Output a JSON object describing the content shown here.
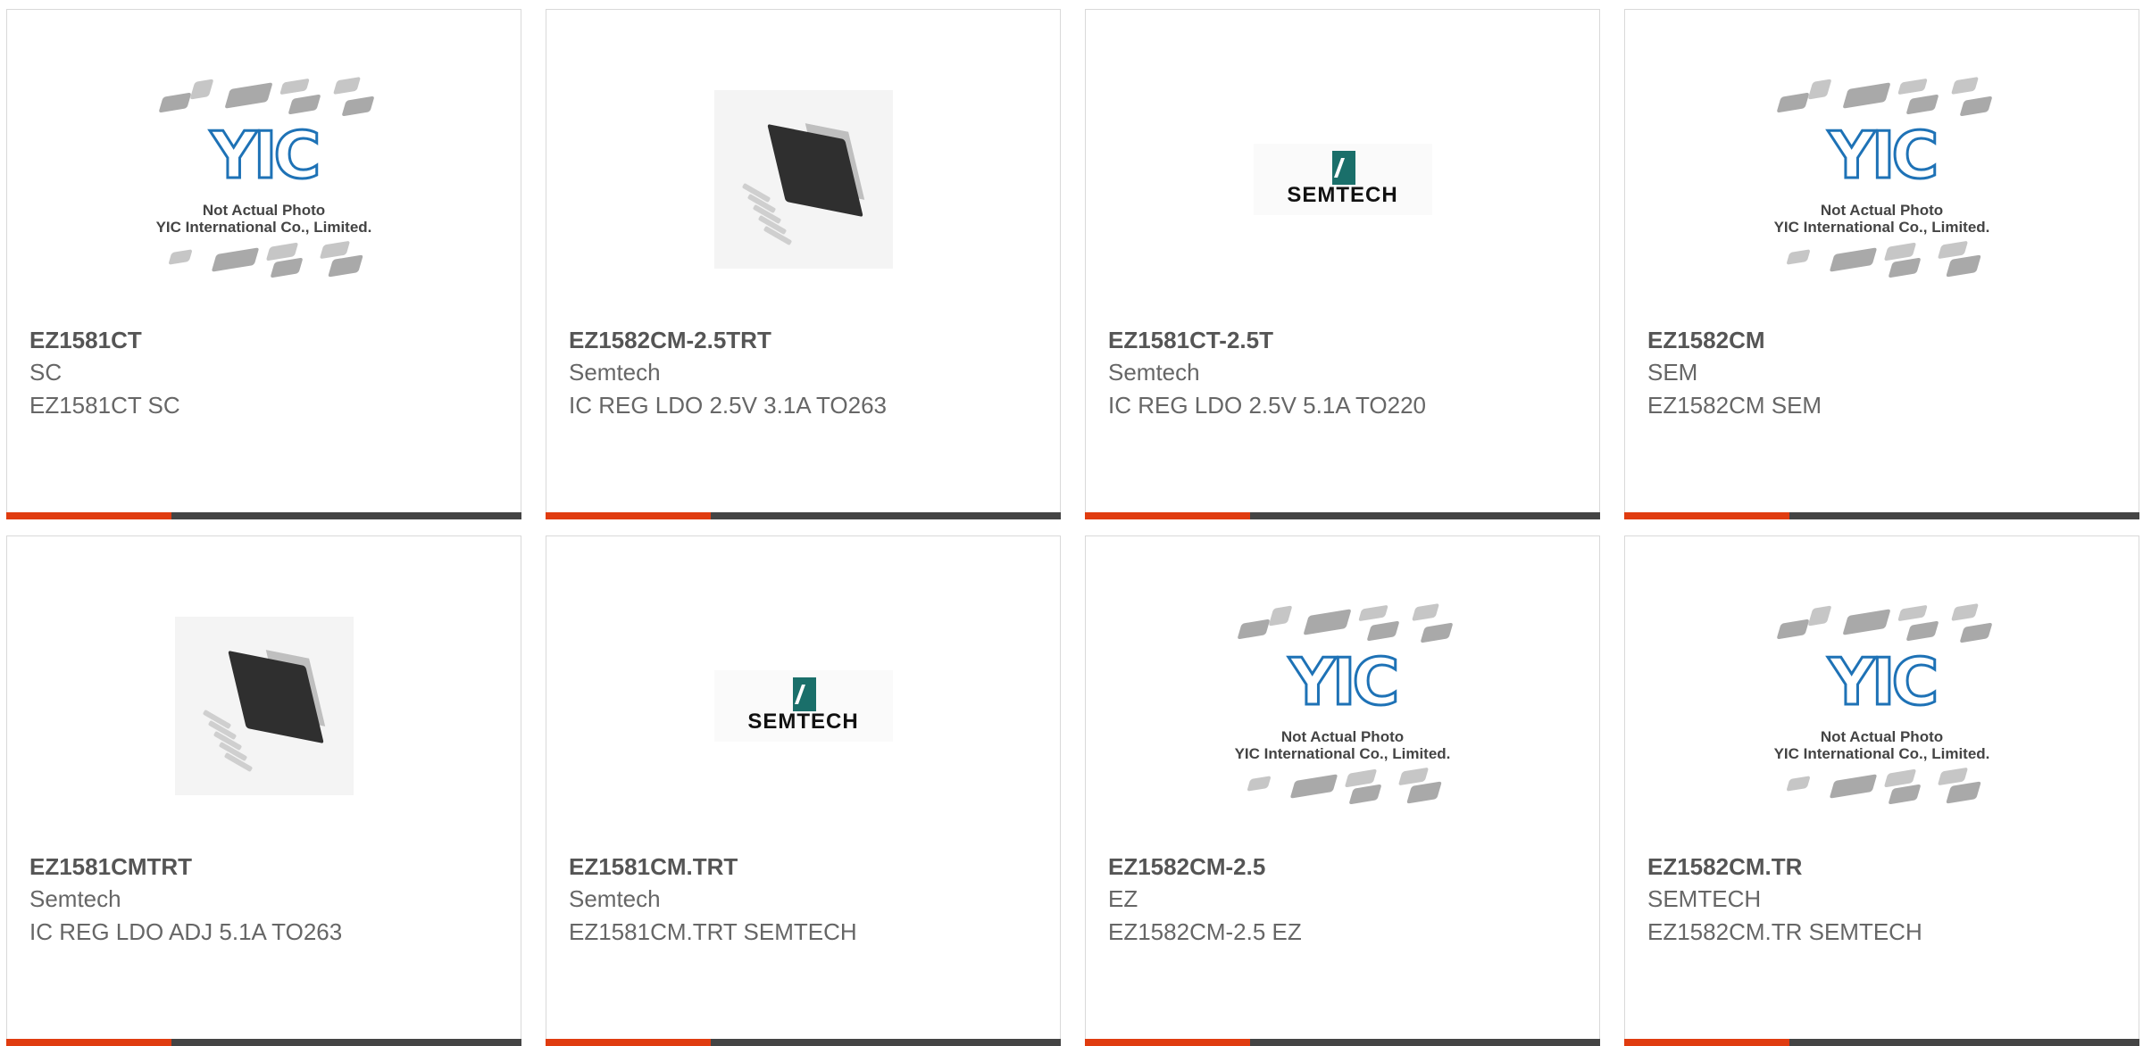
{
  "colors": {
    "accent": "#e03c10",
    "bar": "#444444",
    "border": "#d9d9d9"
  },
  "placeholder": {
    "line1": "Not Actual Photo",
    "line2": "YIC International Co., Limited.",
    "logo": "YIC"
  },
  "semtech_logo": "SEMTECH",
  "cards": [
    {
      "part": "EZ1581CT",
      "manufacturer": "SC",
      "description": "EZ1581CT SC",
      "image": "yic-placeholder"
    },
    {
      "part": "EZ1582CM-2.5TRT",
      "manufacturer": "Semtech",
      "description": "IC REG LDO 2.5V 3.1A TO263",
      "image": "package-photo"
    },
    {
      "part": "EZ1581CT-2.5T",
      "manufacturer": "Semtech",
      "description": "IC REG LDO 2.5V 5.1A TO220",
      "image": "semtech-logo"
    },
    {
      "part": "EZ1582CM",
      "manufacturer": "SEM",
      "description": "EZ1582CM SEM",
      "image": "yic-placeholder"
    },
    {
      "part": "EZ1581CMTRT",
      "manufacturer": "Semtech",
      "description": "IC REG LDO ADJ 5.1A TO263",
      "image": "package-photo"
    },
    {
      "part": "EZ1581CM.TRT",
      "manufacturer": "Semtech",
      "description": "EZ1581CM.TRT SEMTECH",
      "image": "semtech-logo"
    },
    {
      "part": "EZ1582CM-2.5",
      "manufacturer": "EZ",
      "description": "EZ1582CM-2.5 EZ",
      "image": "yic-placeholder"
    },
    {
      "part": "EZ1582CM.TR",
      "manufacturer": "SEMTECH",
      "description": "EZ1582CM.TR SEMTECH",
      "image": "yic-placeholder"
    }
  ]
}
